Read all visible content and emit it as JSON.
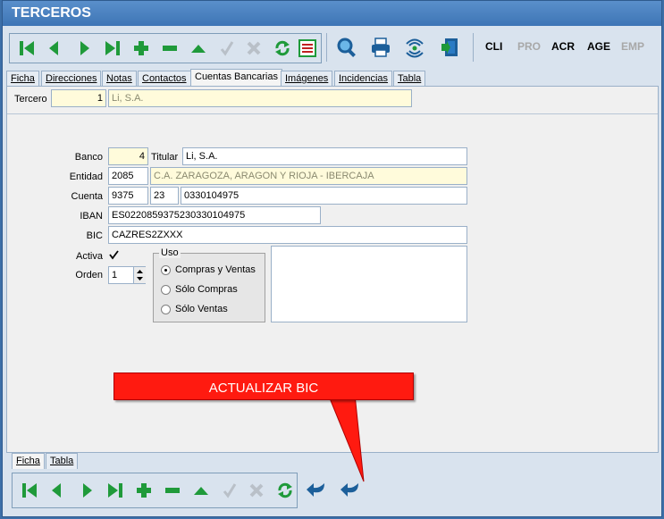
{
  "window": {
    "title": "TERCEROS"
  },
  "toolbar_modes": [
    {
      "label": "CLI",
      "enabled": true
    },
    {
      "label": "PRO",
      "enabled": false
    },
    {
      "label": "ACR",
      "enabled": true
    },
    {
      "label": "AGE",
      "enabled": true
    },
    {
      "label": "EMP",
      "enabled": false
    }
  ],
  "tabs": [
    "Ficha",
    "Direcciones",
    "Notas",
    "Contactos",
    "Cuentas Bancarias",
    "Imágenes",
    "Incidencias",
    "Tabla"
  ],
  "active_tab": "Cuentas Bancarias",
  "tercero": {
    "label": "Tercero",
    "id": "1",
    "name": "Li, S.A."
  },
  "form": {
    "banco_label": "Banco",
    "banco": "4",
    "titular_label": "Titular",
    "titular": "Li, S.A.",
    "entidad_label": "Entidad",
    "entidad_code": "2085",
    "entidad_name": "C.A. ZARAGOZA, ARAGON Y RIOJA - IBERCAJA",
    "cuenta_label": "Cuenta",
    "cuenta_oficina": "9375",
    "cuenta_dc": "23",
    "cuenta_numero": "0330104975",
    "iban_label": "IBAN",
    "iban": "ES0220859375230330104975",
    "bic_label": "BIC",
    "bic": "CAZRES2ZXXX",
    "activa_label": "Activa",
    "activa_checked": true,
    "orden_label": "Orden",
    "orden": "1",
    "uso_label": "Uso",
    "uso_options": [
      "Compras y Ventas",
      "Sólo Compras",
      "Sólo Ventas"
    ],
    "uso_selected": "Compras y Ventas"
  },
  "callout": {
    "text": "ACTUALIZAR BIC",
    "color": "#ff1a10"
  },
  "bottom_tabs": [
    "Ficha",
    "Tabla"
  ],
  "bottom_active_tab": "Ficha",
  "colors": {
    "accent_green": "#1f9a3a",
    "titlebar": "#4a82c0",
    "callout_red": "#ff1a10"
  }
}
